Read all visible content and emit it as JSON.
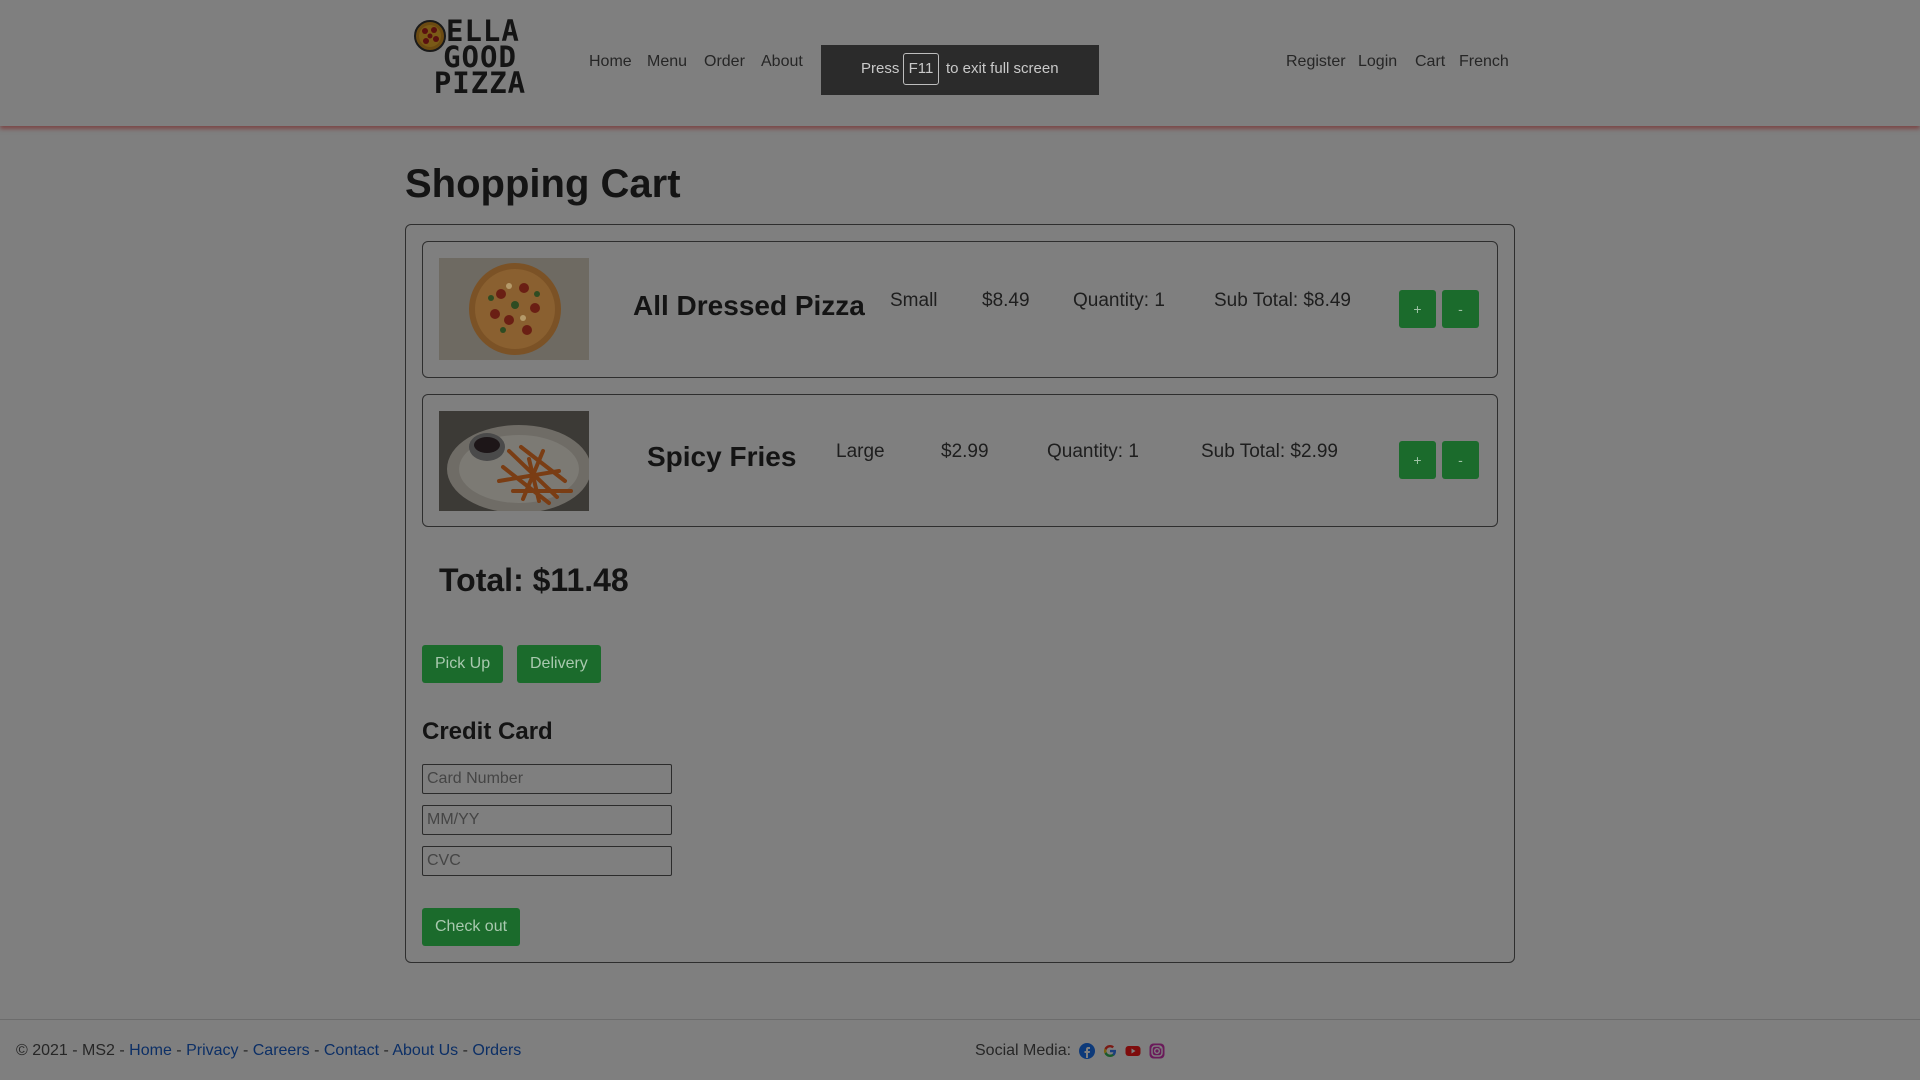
{
  "header": {
    "logo_text": [
      "ELLA",
      "GOOD",
      "PIZZA"
    ],
    "nav_left": [
      "Home",
      "Menu",
      "Order",
      "About"
    ],
    "nav_right": [
      "Register",
      "Login",
      "Cart",
      "French"
    ]
  },
  "toast": {
    "press": "Press",
    "key": "F11",
    "rest": "to exit full screen"
  },
  "page": {
    "title": "Shopping Cart"
  },
  "cart": {
    "items": [
      {
        "name": "All Dressed Pizza",
        "size": "Small",
        "price": "$8.49",
        "quantity": "Quantity: 1",
        "subtotal": "Sub Total: $8.49",
        "plus": "+",
        "minus": "-",
        "image": "pizza-image"
      },
      {
        "name": "Spicy Fries",
        "size": "Large",
        "price": "$2.99",
        "quantity": "Quantity: 1",
        "subtotal": "Sub Total: $2.99",
        "plus": "+",
        "minus": "-",
        "image": "fries-image"
      }
    ],
    "total": "Total: $11.48",
    "pickup_label": "Pick Up",
    "delivery_label": "Delivery",
    "credit_card_title": "Credit Card",
    "card_number_placeholder": "Card Number",
    "expiry_placeholder": "MM/YY",
    "cvc_placeholder": "CVC",
    "checkout_label": "Check out"
  },
  "footer": {
    "copyright": "© 2021 - MS2 - ",
    "links": [
      "Home",
      "Privacy",
      "Careers",
      "Contact",
      "About Us",
      "Orders"
    ],
    "separator": " - ",
    "social_label": "Social Media:",
    "social_icons": [
      "facebook-icon",
      "google-icon",
      "youtube-icon",
      "instagram-icon"
    ]
  },
  "colors": {
    "overlay_background": "#7f7f7f",
    "button_green": "#1b6b2c",
    "link_blue": "#0c2f66",
    "toast_background": "#2b2b2b"
  }
}
